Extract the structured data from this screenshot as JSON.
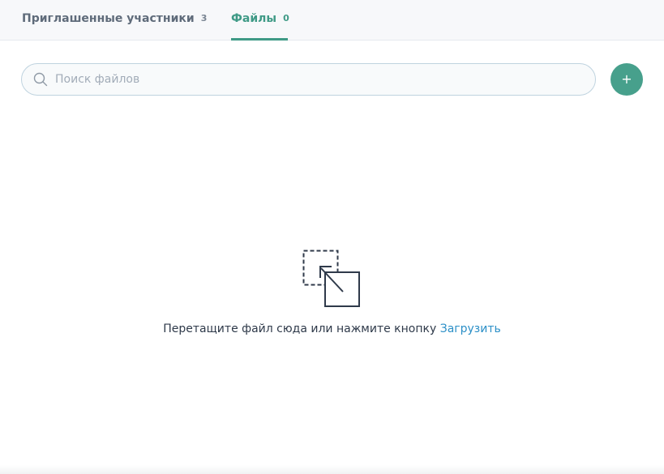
{
  "tabs": {
    "members": {
      "label": "Приглашенные участники",
      "count": "3"
    },
    "files": {
      "label": "Файлы",
      "count": "0",
      "active": true
    }
  },
  "search": {
    "placeholder": "Поиск файлов",
    "value": "",
    "icon": "search-icon"
  },
  "add_button": {
    "label": "+",
    "color": "#47a08c"
  },
  "empty_state": {
    "icon": "drag-drop-icon",
    "text": "Перетащите файл сюда или нажмите кнопку",
    "upload_link": "Загрузить"
  },
  "colors": {
    "accent": "#3f9a86",
    "link": "#2b8fc7",
    "text": "#2f3a4a",
    "muted": "#5f6b7a"
  }
}
